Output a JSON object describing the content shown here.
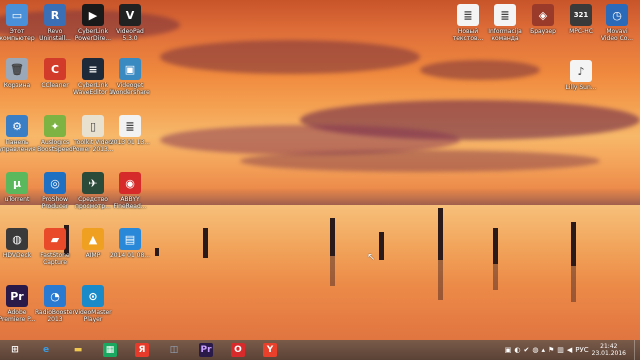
{
  "desktop_icons": [
    {
      "label": "Этот\nкомпьютер",
      "icon": "computer-icon",
      "color": "#4a90d9",
      "glyph": "▭"
    },
    {
      "label": "Revo\nUninstall...",
      "icon": "revo-uninstaller-icon",
      "color": "#3b6fb5",
      "glyph": "R"
    },
    {
      "label": "CyberLink\nPowerDire...",
      "icon": "powerdirector-icon",
      "color": "#1a1a1a",
      "glyph": "▶"
    },
    {
      "label": "VideoPad 5.3.0",
      "icon": "videopad-icon",
      "color": "#222222",
      "glyph": "V"
    },
    {
      "label": "Корзина",
      "icon": "recycle-bin-icon",
      "color": "#9aa8b8",
      "glyph": "🗑"
    },
    {
      "label": "CCleaner",
      "icon": "ccleaner-icon",
      "color": "#d23a2a",
      "glyph": "C"
    },
    {
      "label": "CyberLink\nWaveEditor 2",
      "icon": "waveeditor-icon",
      "color": "#1c2a3a",
      "glyph": "≡"
    },
    {
      "label": "Videoget\nWondershare",
      "icon": "videoget-icon",
      "color": "#3a8ac2",
      "glyph": "▣"
    },
    {
      "label": "Панель\nуправления",
      "icon": "control-panel-icon",
      "color": "#3a7ec6",
      "glyph": "⚙"
    },
    {
      "label": "Auslogics\nBoostSpeed",
      "icon": "auslogics-icon",
      "color": "#7cb342",
      "glyph": "✦"
    },
    {
      "label": "Toolkit Video\nPower 2013...",
      "icon": "toolkit-video-icon",
      "color": "#e9e1d0",
      "glyph": "▯"
    },
    {
      "label": "2013 01 13...",
      "icon": "document-icon",
      "color": "#f2f2f2",
      "glyph": "≣"
    },
    {
      "label": "uTorrent",
      "icon": "utorrent-icon",
      "color": "#5cb85c",
      "glyph": "µ"
    },
    {
      "label": "ProShow\nProducer",
      "icon": "proshow-icon",
      "color": "#1f6fc2",
      "glyph": "◎"
    },
    {
      "label": "Средство\nпросмотр...",
      "icon": "viewer-icon",
      "color": "#2a4a3a",
      "glyph": "✈"
    },
    {
      "label": "ABBYY\nFineRead...",
      "icon": "abbyy-icon",
      "color": "#d62a2a",
      "glyph": "◉"
    },
    {
      "label": "HDVDeck",
      "icon": "hdvdeck-icon",
      "color": "#3a3a3a",
      "glyph": "◍"
    },
    {
      "label": "FastStone\nCapture",
      "icon": "faststone-icon",
      "color": "#e84a2a",
      "glyph": "▰"
    },
    {
      "label": "AIMP",
      "icon": "aimp-icon",
      "color": "#f0a020",
      "glyph": "▲"
    },
    {
      "label": "2014 01 08...",
      "icon": "image-file-icon",
      "color": "#2a88d8",
      "glyph": "▤"
    },
    {
      "label": "Adobe\nPremiere P...",
      "icon": "premiere-icon",
      "color": "#2a1a4a",
      "glyph": "Pr"
    },
    {
      "label": "RadioBooster\n2013",
      "icon": "radiobooster-icon",
      "color": "#2a7ad2",
      "glyph": "◔"
    },
    {
      "label": "VideoMaster\nPlayer",
      "icon": "videomaster-icon",
      "color": "#1a8ac8",
      "glyph": "⊙"
    }
  ],
  "right_icons": [
    {
      "label": "Новый\nтекстов...",
      "icon": "text-file-icon",
      "color": "#f4f4f4",
      "glyph": "≣"
    },
    {
      "label": "Informacija\nкоманда",
      "icon": "text-file-icon",
      "color": "#f4f4f4",
      "glyph": "≣"
    },
    {
      "label": "Браузер",
      "icon": "browser-icon",
      "color": "#9a3a2a",
      "glyph": "◈"
    },
    {
      "label": "MPC-HC",
      "icon": "mpc-hc-icon",
      "color": "#3a3a3a",
      "glyph": "321"
    },
    {
      "label": "Movavi\nVideo Co...",
      "icon": "movavi-icon",
      "color": "#2a6ab8",
      "glyph": "◷"
    },
    {
      "label": "Lilly Sun...",
      "icon": "mp3-file-icon",
      "color": "#f4f4f4",
      "glyph": "♪"
    }
  ],
  "taskbar": {
    "buttons": [
      {
        "name": "start-button",
        "icon": "windows-logo-icon",
        "glyph": "⊞",
        "color": "#ffffff"
      },
      {
        "name": "ie-button",
        "icon": "internet-explorer-icon",
        "glyph": "e",
        "color": "#3a9ae0"
      },
      {
        "name": "explorer-button",
        "icon": "folder-icon",
        "glyph": "▬",
        "color": "#f0c850"
      },
      {
        "name": "store-button",
        "icon": "store-icon",
        "glyph": "▦",
        "color": "#1aa860"
      },
      {
        "name": "yandex-button",
        "icon": "yandex-icon",
        "glyph": "Я",
        "color": "#e83a2a"
      },
      {
        "name": "network-button",
        "icon": "network-icon",
        "glyph": "◫",
        "color": "#9ab0c8"
      },
      {
        "name": "premiere-button",
        "icon": "premiere-icon",
        "glyph": "Pr",
        "color": "#2a1a4a"
      },
      {
        "name": "opera-button",
        "icon": "opera-icon",
        "glyph": "O",
        "color": "#d82a2a"
      },
      {
        "name": "yandex-browser-button",
        "icon": "yandex-browser-icon",
        "glyph": "Y",
        "color": "#e8402a"
      }
    ],
    "tray": {
      "language": "РУС",
      "time": "21:42",
      "date": "23.01.2016"
    }
  }
}
